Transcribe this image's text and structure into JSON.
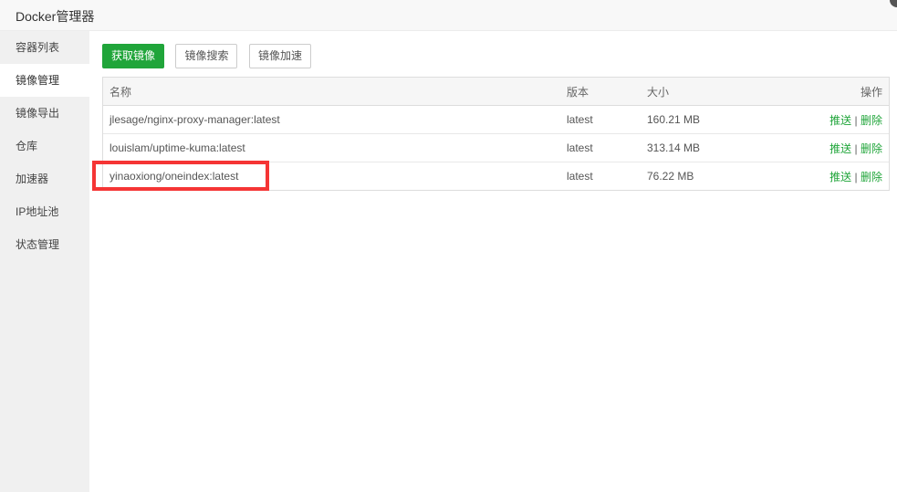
{
  "window": {
    "title": "Docker管理器"
  },
  "sidebar": {
    "items": [
      {
        "label": "容器列表",
        "active": false
      },
      {
        "label": "镜像管理",
        "active": true
      },
      {
        "label": "镜像导出",
        "active": false
      },
      {
        "label": "仓库",
        "active": false
      },
      {
        "label": "加速器",
        "active": false
      },
      {
        "label": "IP地址池",
        "active": false
      },
      {
        "label": "状态管理",
        "active": false
      }
    ]
  },
  "toolbar": {
    "pull_label": "获取镜像",
    "search_label": "镜像搜索",
    "accel_label": "镜像加速"
  },
  "table": {
    "headers": {
      "name": "名称",
      "version": "版本",
      "size": "大小",
      "actions": "操作"
    },
    "rows": [
      {
        "name": "jlesage/nginx-proxy-manager:latest",
        "version": "latest",
        "size": "160.21 MB",
        "push": "推送",
        "sep": "|",
        "delete": "删除"
      },
      {
        "name": "louislam/uptime-kuma:latest",
        "version": "latest",
        "size": "313.14 MB",
        "push": "推送",
        "sep": "|",
        "delete": "删除"
      },
      {
        "name": "yinaoxiong/oneindex:latest",
        "version": "latest",
        "size": "76.22 MB",
        "push": "推送",
        "sep": "|",
        "delete": "删除"
      }
    ]
  },
  "colors": {
    "accent": "#20a53a",
    "highlight": "#f53535"
  }
}
